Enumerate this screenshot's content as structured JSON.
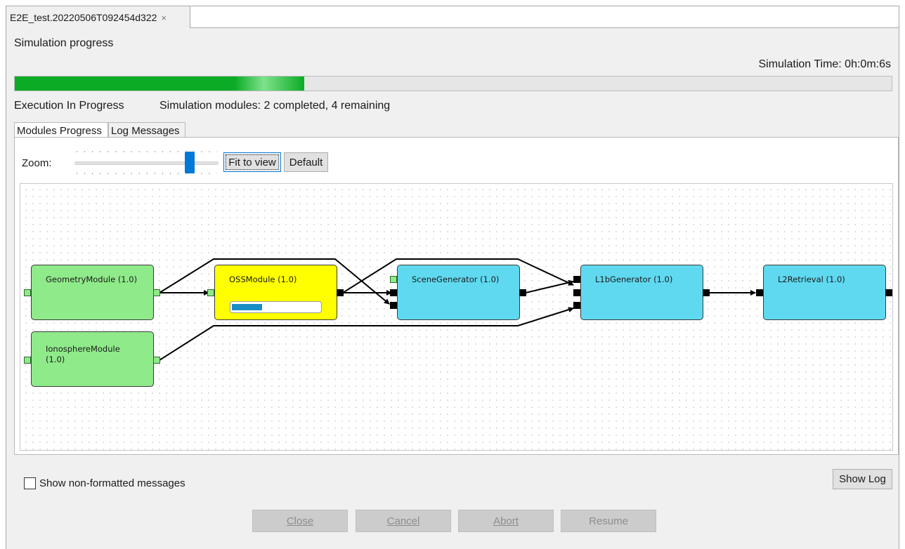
{
  "window": {
    "tab_title": "E2E_test.20220506T092454d322",
    "tab_close": "×"
  },
  "header": {
    "title": "Simulation progress",
    "sim_time": "Simulation Time: 0h:0m:6s",
    "progress_fraction": 0.33,
    "status": "Execution In Progress",
    "modules_summary": "Simulation modules: 2 completed, 4 remaining"
  },
  "tabs": [
    {
      "label": "Modules Progress"
    },
    {
      "label": "Log Messages"
    }
  ],
  "zoom": {
    "label": "Zoom:",
    "level_fraction": 0.8,
    "fit_label": "Fit to view",
    "default_label": "Default"
  },
  "modules": {
    "geometry": {
      "label": "GeometryModule (1.0)",
      "status": "completed"
    },
    "ionosphere": {
      "label": "IonosphereModule (1.0)",
      "status": "completed"
    },
    "oss": {
      "label": "OSSModule (1.0)",
      "status": "running",
      "progress_fraction": 0.34
    },
    "scene": {
      "label": "SceneGenerator (1.0)",
      "status": "pending"
    },
    "l1b": {
      "label": "L1bGenerator (1.0)",
      "status": "pending"
    },
    "l2": {
      "label": "L2Retrieval (1.0)",
      "status": "pending"
    }
  },
  "status_colors": {
    "completed": "#8fea8a",
    "running": "#ffff00",
    "pending": "#5fd9f0"
  },
  "options": {
    "show_raw_label": "Show non-formatted messages",
    "show_raw_checked": false,
    "show_log_label": "Show Log"
  },
  "footer": {
    "close": "Close",
    "cancel": "Cancel",
    "abort": "Abort",
    "resume": "Resume"
  }
}
